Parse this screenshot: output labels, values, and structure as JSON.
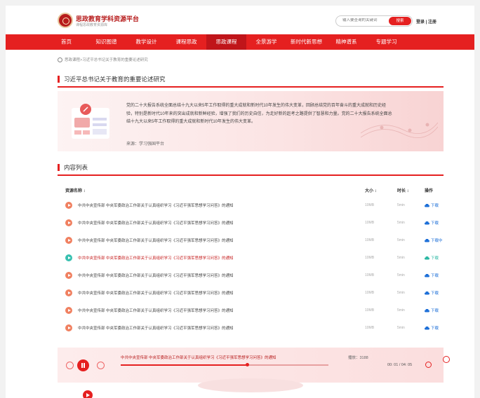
{
  "brand": {
    "title": "思政教育学科资源平台",
    "subtitle": "课程思政教育资源库"
  },
  "search": {
    "placeholder": "输入要查询的关键词",
    "button": "搜索"
  },
  "auth": {
    "label": "登录 | 注册"
  },
  "nav": {
    "items": [
      "首页",
      "知识图谱",
      "教学设计",
      "课程思政",
      "思政课程",
      "全景游学",
      "新时代新思想",
      "精神谱系",
      "专题学习"
    ],
    "active_index": 4
  },
  "breadcrumb": "思政课程>习近平总书记关于教育的重要论述研究",
  "intro": {
    "title": "习近平总书记关于教育的重要论述研究",
    "body": "党的二十大报告系统全面总结十九大以来5年工作取得的重大成就和新时代10年发生的伟大变革，回顾总结党的百年奋斗的重大成就和历史经验，特别是新时代10年来的突出成就和新鲜经验，增强了我们的历史自信，为走好新的赶考之路提供了智慧和力量。党的二十大报告系统全面总结十九大以来5年工作取得的重大成就和新时代10年发生的伟大变革。",
    "source": "来源：学习强国平台"
  },
  "content": {
    "title": "内容列表",
    "columns": {
      "name": "资源名称 ↕",
      "size": "大小 ↕",
      "duration": "时长 ↕",
      "action": "操作"
    },
    "rows": [
      {
        "name": "中共中央宣传部 中央军委政治工作部关于认真组织学习《习近平强军思想学习问答》的通知",
        "size": "10MB",
        "duration": "5min",
        "action": "下载"
      },
      {
        "name": "中共中央宣传部 中央军委政治工作部关于认真组织学习《习近平强军思想学习问答》的通知",
        "size": "10MB",
        "duration": "5min",
        "action": "下载"
      },
      {
        "name": "中共中央宣传部 中央军委政治工作部关于认真组织学习《习近平强军思想学习问答》的通知",
        "size": "10MB",
        "duration": "5min",
        "action": "下载中"
      },
      {
        "name": "中共中央宣传部 中央军委政治工作部关于认真组织学习《习近平强军思想学习问答》的通知",
        "size": "10MB",
        "duration": "5min",
        "action": "下载"
      },
      {
        "name": "中共中央宣传部 中央军委政治工作部关于认真组织学习《习近平强军思想学习问答》的通知",
        "size": "10MB",
        "duration": "5min",
        "action": "下载"
      },
      {
        "name": "中共中央宣传部 中央军委政治工作部关于认真组织学习《习近平强军思想学习问答》的通知",
        "size": "10MB",
        "duration": "5min",
        "action": "下载"
      },
      {
        "name": "中共中央宣传部 中央军委政治工作部关于认真组织学习《习近平强军思想学习问答》的通知",
        "size": "10MB",
        "duration": "5min",
        "action": "下载"
      },
      {
        "name": "中共中央宣传部 中央军委政治工作部关于认真组织学习《习近平强军思想学习问答》的通知",
        "size": "10MB",
        "duration": "5min",
        "action": "下载"
      }
    ],
    "current_row": 3
  },
  "player": {
    "title": "中共中央宣传部 中央军委政治工作部关于认真组织学习《习近平强军思想学习问答》的通知",
    "play_count": "播放：3188",
    "time": "00: 01 / 04: 05",
    "progress": 0.61
  },
  "colors": {
    "accent": "#e52020",
    "dark_accent": "#c0151a",
    "download": "#1e70d8",
    "downloading": "#2cb8a4"
  }
}
